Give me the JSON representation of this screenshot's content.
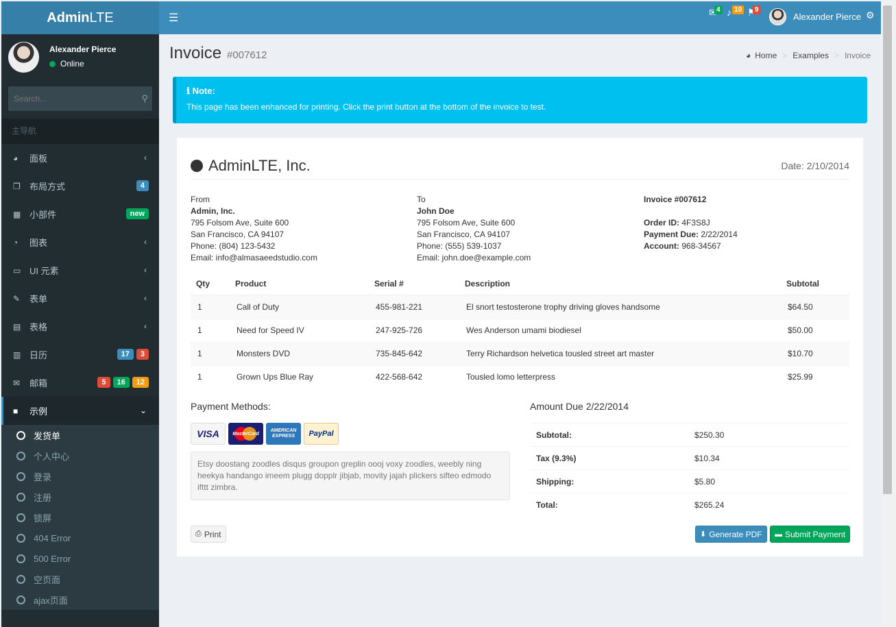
{
  "logo": {
    "bold": "Admin",
    "rest": "LTE"
  },
  "navbar": {
    "toggle_icon": "☰",
    "messages_count": "4",
    "notifications_count": "10",
    "tasks_count": "9",
    "user_name": "Alexander Pierce",
    "colors": {
      "messages": "#00a65a",
      "notifications": "#f39c12",
      "tasks": "#dd4b39"
    }
  },
  "sidebar": {
    "user_name": "Alexander Pierce",
    "status": "Online",
    "search_placeholder": "Search...",
    "header": "主导航",
    "items": [
      {
        "label": "面板",
        "icon": "dashboard-icon"
      },
      {
        "label": "布局方式",
        "icon": "files-icon",
        "badge": "4"
      },
      {
        "label": "小部件",
        "icon": "th-icon",
        "badge": "new"
      },
      {
        "label": "图表",
        "icon": "pie-chart-icon"
      },
      {
        "label": "UI 元素",
        "icon": "laptop-icon"
      },
      {
        "label": "表单",
        "icon": "edit-icon"
      },
      {
        "label": "表格",
        "icon": "table-icon"
      },
      {
        "label": "日历",
        "icon": "calendar-icon",
        "badges": [
          "17",
          "3"
        ]
      },
      {
        "label": "邮箱",
        "icon": "envelope-icon",
        "badges": [
          "5",
          "16",
          "12"
        ]
      },
      {
        "label": "示例",
        "icon": "folder-icon"
      }
    ],
    "subitems": [
      "发货单",
      "个人中心",
      "登录",
      "注册",
      "锁屏",
      "404 Error",
      "500 Error",
      "空页面",
      "ajax页面"
    ]
  },
  "content": {
    "title": "Invoice",
    "subtitle": "#007612",
    "breadcrumb": [
      "Home",
      "Examples",
      "Invoice"
    ]
  },
  "callout": {
    "title": "Note:",
    "text": "This page has been enhanced for printing. Click the print button at the bottom of the invoice to test."
  },
  "invoice": {
    "company": "AdminLTE, Inc.",
    "date": "Date: 2/10/2014",
    "from": {
      "label": "From",
      "name": "Admin, Inc.",
      "line1": "795 Folsom Ave, Suite 600",
      "line2": "San Francisco, CA 94107",
      "phone": "Phone: (804) 123-5432",
      "email": "Email: info@almasaeedstudio.com"
    },
    "to": {
      "label": "To",
      "name": "John Doe",
      "line1": "795 Folsom Ave, Suite 600",
      "line2": "San Francisco, CA 94107",
      "phone": "Phone: (555) 539-1037",
      "email": "Email: john.doe@example.com"
    },
    "info": {
      "invoice_no": "Invoice #007612",
      "order_label": "Order ID:",
      "order": "4F3S8J",
      "due_label": "Payment Due:",
      "due": "2/22/2014",
      "account_label": "Account:",
      "account": "968-34567"
    },
    "columns": [
      "Qty",
      "Product",
      "Serial #",
      "Description",
      "Subtotal"
    ],
    "rows": [
      [
        "1",
        "Call of Duty",
        "455-981-221",
        "El snort testosterone trophy driving gloves handsome",
        "$64.50"
      ],
      [
        "1",
        "Need for Speed IV",
        "247-925-726",
        "Wes Anderson umami biodiesel",
        "$50.00"
      ],
      [
        "1",
        "Monsters DVD",
        "735-845-642",
        "Terry Richardson helvetica tousled street art master",
        "$10.70"
      ],
      [
        "1",
        "Grown Ups Blue Ray",
        "422-568-642",
        "Tousled lomo letterpress",
        "$25.99"
      ]
    ],
    "payment_title": "Payment Methods:",
    "cards": {
      "visa": "VISA",
      "mastercard": "MasterCard",
      "amex": "AMERICAN EXPRESS",
      "paypal": "PayPal"
    },
    "payment_note": "Etsy doostang zoodles disqus groupon greplin oooj voxy zoodles, weebly ning heekya handango imeem plugg dopplr jibjab, movity jajah plickers sifteo edmodo ifttt zimbra.",
    "amount_title": "Amount Due 2/22/2014",
    "totals": [
      [
        "Subtotal:",
        "$250.30"
      ],
      [
        "Tax (9.3%)",
        "$10.34"
      ],
      [
        "Shipping:",
        "$5.80"
      ],
      [
        "Total:",
        "$265.24"
      ]
    ],
    "buttons": {
      "print": "Print",
      "pdf": "Generate PDF",
      "pay": "Submit Payment"
    }
  }
}
